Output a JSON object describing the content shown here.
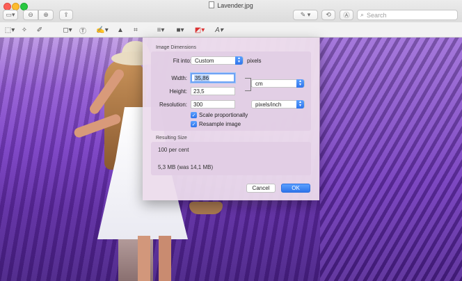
{
  "window": {
    "title": "Lavender.jpg"
  },
  "toolbar": {
    "search_placeholder": "Search",
    "sidebar_icon": "sidebar-icon",
    "zoom_out_icon": "zoom-out-icon",
    "zoom_in_icon": "zoom-in-icon",
    "share_icon": "share-icon",
    "markup_icon": "pen-markup-icon",
    "rotate_icon": "rotate-icon",
    "annotate_icon": "annotate-icon"
  },
  "markup_tools": [
    "selection-icon",
    "instant-alpha-icon",
    "sketch-icon",
    "shapes-icon",
    "text-icon",
    "sign-icon",
    "adjust-color-icon",
    "crop-icon",
    "line-style-icon",
    "border-color-icon",
    "fill-color-icon",
    "text-style-icon"
  ],
  "dialog": {
    "section_image_dimensions": "Image Dimensions",
    "fit_into_label": "Fit into:",
    "fit_into_value": "Custom",
    "fit_into_unit": "pixels",
    "width_label": "Width:",
    "width_value": "35,86",
    "height_label": "Height:",
    "height_value": "23,5",
    "size_unit": "cm",
    "resolution_label": "Resolution:",
    "resolution_value": "300",
    "resolution_unit": "pixels/inch",
    "scale_proportionally": "Scale proportionally",
    "resample_image": "Resample image",
    "section_resulting_size": "Resulting Size",
    "result_percent": "100 per cent",
    "result_size": "5,3 MB (was 14,1 MB)",
    "cancel_label": "Cancel",
    "ok_label": "OK"
  },
  "colors": {
    "accent": "#2f74ea",
    "sheet_bg": "#ecdcec"
  }
}
